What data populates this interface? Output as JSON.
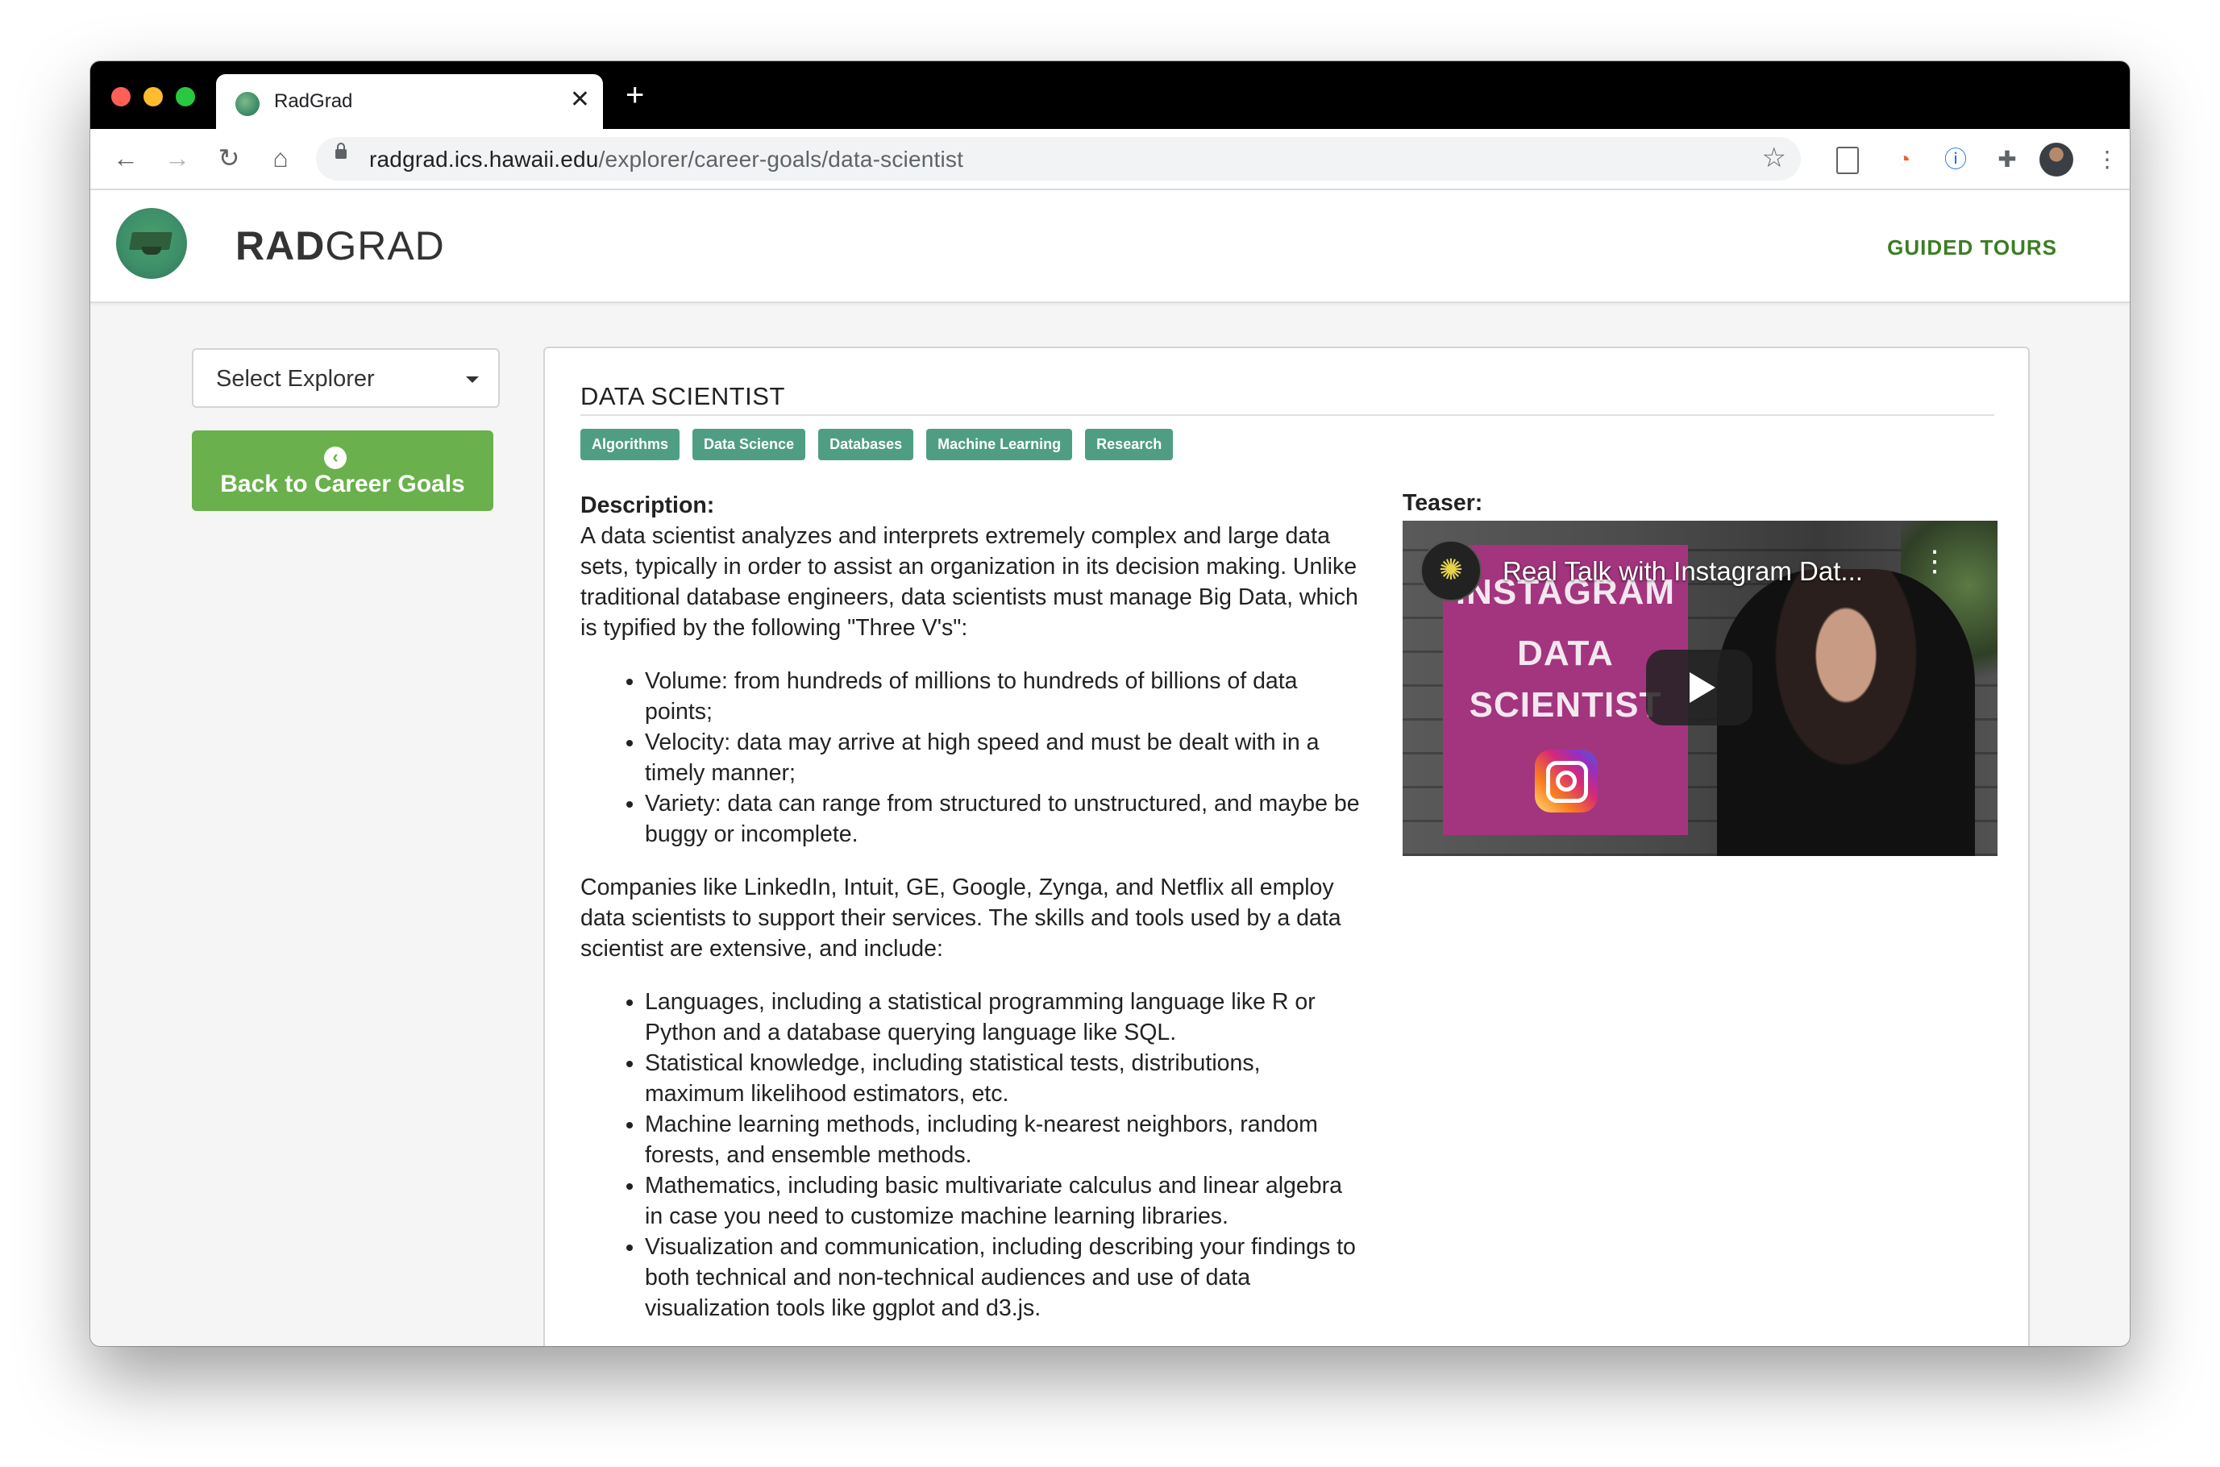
{
  "browser": {
    "tab_title": "RadGrad",
    "url_host": "radgrad.ics.hawaii.edu",
    "url_path": "/explorer/career-goals/data-scientist"
  },
  "site": {
    "brand_bold": "RAD",
    "brand_rest": "GRAD",
    "guided_tours": "GUIDED TOURS"
  },
  "sidebar": {
    "select_label": "Select Explorer",
    "back_label": "Back to Career Goals"
  },
  "career": {
    "title": "DATA SCIENTIST",
    "tags": [
      "Algorithms",
      "Data Science",
      "Databases",
      "Machine Learning",
      "Research"
    ],
    "description_heading": "Description:",
    "intro": "A data scientist analyzes and interprets extremely complex and large data sets, typically in order to assist an organization in its decision making. Unlike traditional database engineers, data scientists must manage Big Data, which is typified by the following \"Three V's\":",
    "three_vs": [
      "Volume: from hundreds of millions to hundreds of billions of data points;",
      "Velocity: data may arrive at high speed and must be dealt with in a timely manner;",
      "Variety: data can range from structured to unstructured, and maybe be buggy or incomplete."
    ],
    "companies": "Companies like LinkedIn, Intuit, GE, Google, Zynga, and Netflix all employ data scientists to support their services. The skills and tools used by a data scientist are extensive, and include:",
    "skills": [
      "Languages, including a statistical programming language like R or Python and a database querying language like SQL.",
      "Statistical knowledge, including statistical tests, distributions, maximum likelihood estimators, etc.",
      "Machine learning methods, including k-nearest neighbors, random forests, and ensemble methods.",
      "Mathematics, including basic multivariate calculus and linear algebra in case you need to customize machine learning libraries.",
      "Visualization and communication, including describing your findings to both technical and non-technical audiences and use of data visualization tools like ggplot and d3.js."
    ],
    "teaser_label": "Teaser:",
    "video_title": "Real Talk with Instagram Dat...",
    "poster_lines": [
      "INSTAGRAM",
      "DATA",
      "SCIENTIST"
    ]
  },
  "icons": {
    "back": "chevron-left-circle-icon",
    "play": "play-icon",
    "instagram": "instagram-icon"
  },
  "colors": {
    "brand_green": "#6ab04c",
    "tag_teal": "#4f9e83",
    "guided_green": "#3b7d23"
  }
}
